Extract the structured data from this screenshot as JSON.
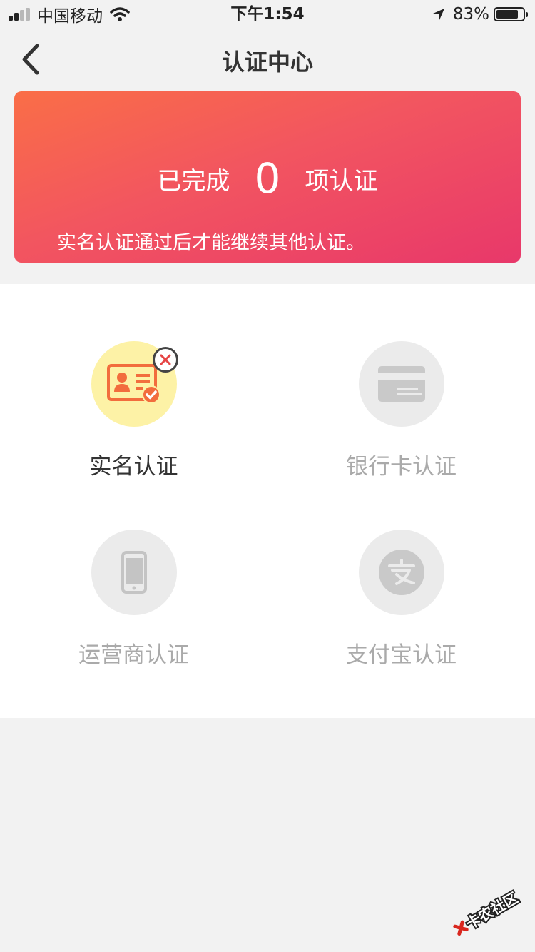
{
  "status_bar": {
    "carrier": "中国移动",
    "time": "下午1:54",
    "battery_percent": "83%",
    "battery_level": 0.83,
    "icons": [
      "signal-icon",
      "wifi-icon",
      "location-icon",
      "battery-icon"
    ]
  },
  "nav": {
    "title": "认证中心",
    "back_icon": "chevron-left-icon"
  },
  "summary": {
    "prefix": "已完成",
    "count": "0",
    "suffix": "项认证",
    "note": "实名认证通过后才能继续其他认证。",
    "gradient_colors": [
      "#fa6e47",
      "#f25560",
      "#e8386a"
    ]
  },
  "verifications": [
    {
      "label": "实名认证",
      "icon": "id-card-icon",
      "status": "incomplete",
      "status_icon": "close-icon",
      "active": true
    },
    {
      "label": "银行卡认证",
      "icon": "bank-card-icon",
      "active": false
    },
    {
      "label": "运营商认证",
      "icon": "phone-icon",
      "active": false
    },
    {
      "label": "支付宝认证",
      "icon": "alipay-icon",
      "active": false
    }
  ],
  "watermark": {
    "text": "卡农社区"
  },
  "colors": {
    "background": "#f2f2f2",
    "active_circle": "#fdf2a6",
    "inactive_circle": "#ebebeb",
    "active_icon": "#f26d3d",
    "inactive_text": "#aaaaaa"
  }
}
